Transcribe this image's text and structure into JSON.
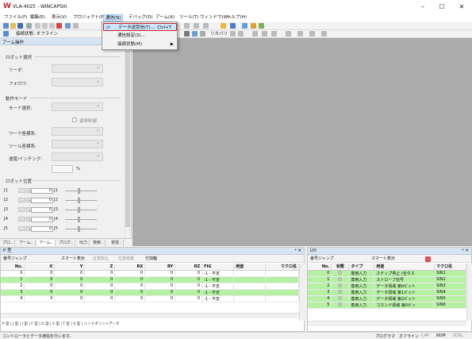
{
  "window": {
    "title": "VLA-4025 - WINCAPSIII",
    "minimize": "–",
    "maximize": "☐",
    "close": "✕"
  },
  "menubar": [
    "ファイル(F)",
    "編集(E)",
    "表示(V)",
    "プロジェクト(P)",
    "通信(N)",
    "デバッグ(D)",
    "アーム(A)",
    "ツール(T)",
    "ウィンドウ(W)",
    "ヘルプ(H)"
  ],
  "toolbar2": {
    "connection_label": "接続状態: オフライン",
    "arm_label": "リカバリ"
  },
  "dropdown": {
    "items": [
      {
        "label": "データ送受信(T)...",
        "shortcut": "Ctrl+T"
      },
      {
        "label": "通信設定(S)..."
      },
      {
        "label": "接続状態(M)",
        "submenu_arrow": "▶"
      }
    ]
  },
  "arm_panel": {
    "title": "アーム操作",
    "robot_group": "ロボット選択",
    "leader_label": "リーダ:",
    "follower_label": "フォロワ:",
    "mode_group": "動作モード",
    "mode_label": "モード選択:",
    "sync_label": "姿勢制御",
    "work_label": "ワーク座標系:",
    "tool_label": "ツール座標系:",
    "speed_label": "速度/インチング:",
    "speed_unit": "%",
    "pos_group": "ロボット位置",
    "joints": [
      {
        "name": "J1",
        "value": "0",
        "right": "J1"
      },
      {
        "name": "J2",
        "value": "0",
        "right": "J2"
      },
      {
        "name": "J3",
        "value": "0",
        "right": "J3"
      },
      {
        "name": "J4",
        "value": "0",
        "right": "J4"
      },
      {
        "name": "J5",
        "value": "0",
        "right": "J5"
      }
    ],
    "tabs": [
      "プロ..",
      "アーム..",
      "アーム..",
      "プログ..",
      "出力",
      "検索..",
      "視覚.."
    ]
  },
  "p_panel": {
    "title": "P 型",
    "pin": "ᵠ ✕",
    "toolbar": {
      "jump": "番号ジャンプ",
      "smart": "スマート表示",
      "paste": "位置取込",
      "pos_apply": "位置移動",
      "marked": "付加軸"
    },
    "columns": [
      "No.",
      "X",
      "Y",
      "Z",
      "RX",
      "RY",
      "RZ",
      "FIG",
      "用途",
      "マクロ名"
    ],
    "rows": [
      {
        "no": "0",
        "x": "0",
        "y": "0",
        "z": "0",
        "rx": "0",
        "ry": "0",
        "rz": "0",
        "fig": "-1 - 不定",
        "use": "",
        "macro": "",
        "style": "w"
      },
      {
        "no": "1",
        "x": "0",
        "y": "0",
        "z": "0",
        "rx": "0",
        "ry": "0",
        "rz": "0",
        "fig": "-1 - 不定",
        "use": "",
        "macro": "",
        "style": "g"
      },
      {
        "no": "2",
        "x": "0",
        "y": "0",
        "z": "0",
        "rx": "0",
        "ry": "0",
        "rz": "0",
        "fig": "-1 - 不定",
        "use": "",
        "macro": "",
        "style": "w"
      },
      {
        "no": "3",
        "x": "0",
        "y": "0",
        "z": "0",
        "rx": "0",
        "ry": "0",
        "rz": "0",
        "fig": "-1 - 不定",
        "use": "",
        "macro": "",
        "style": "g"
      },
      {
        "no": "4",
        "x": "0",
        "y": "0",
        "z": "0",
        "rx": "0",
        "ry": "0",
        "rz": "0",
        "fig": "-1 - 不定",
        "use": "",
        "macro": "",
        "style": "w"
      }
    ],
    "tabs": "P 型 | J 型 | I 型 | F 型 | D 型 | V 型 | T 型 | S 型 | ハンドポイントデータ"
  },
  "io_panel": {
    "title": "I/O",
    "pin": "ᵠ ✕",
    "toolbar": {
      "jump": "番号ジャンプ",
      "smart": "スマート表示"
    },
    "columns": [
      "No.",
      "状態",
      "タイプ",
      "用途",
      "マクロ名"
    ],
    "rows": [
      {
        "no": "0",
        "type": "専用入力",
        "use": "ステップ停止 (全タス",
        "macro": "SIN1",
        "style": "g"
      },
      {
        "no": "1",
        "type": "専用入力",
        "use": "ストローブ信号",
        "macro": "SIN2",
        "style": "g"
      },
      {
        "no": "2",
        "type": "専用入力",
        "use": "データ領域 第0ビット",
        "macro": "SIN3",
        "style": "g"
      },
      {
        "no": "3",
        "type": "専用入力",
        "use": "データ領域 第1ビット",
        "macro": "SIN4",
        "style": "g"
      },
      {
        "no": "4",
        "type": "専用入力",
        "use": "データ領域 第2ビット",
        "macro": "SIN5",
        "style": "g"
      },
      {
        "no": "5",
        "type": "専用入力",
        "use": "コマンド領域 第0ビッ",
        "macro": "SIN6",
        "style": "g"
      }
    ]
  },
  "statusbar": {
    "message": "コントローラとデータ通信を行います。",
    "mode": "プログラマ",
    "online": "オフライン",
    "cap": "CAP",
    "num": "NUM",
    "scrl": "SCRL"
  },
  "colors": {
    "highlight": "#cce4f7",
    "red_outline": "#d0202a",
    "green_row": "#b5f0a3",
    "workspace": "#ababab"
  }
}
